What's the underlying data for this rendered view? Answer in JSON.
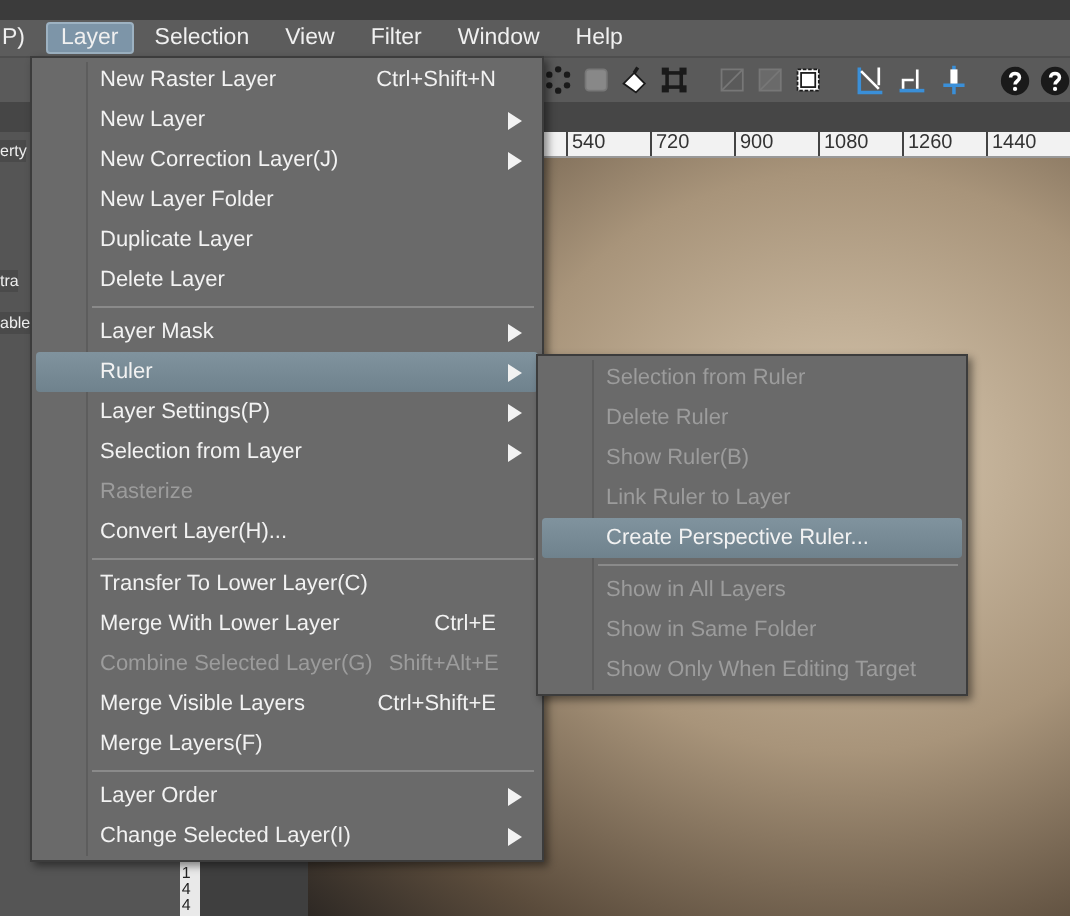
{
  "menubar": [
    {
      "label": "P)",
      "selected": false
    },
    {
      "label": "Layer",
      "selected": true
    },
    {
      "label": "Selection",
      "selected": false
    },
    {
      "label": "View",
      "selected": false
    },
    {
      "label": "Filter",
      "selected": false
    },
    {
      "label": "Window",
      "selected": false
    },
    {
      "label": "Help",
      "selected": false
    }
  ],
  "left_panel": {
    "labels": [
      "erty",
      "tra",
      "able"
    ]
  },
  "ruler": {
    "labels": [
      "540",
      "720",
      "900",
      "1080",
      "1260",
      "1440"
    ]
  },
  "vertical_ruler": {
    "label": "144"
  },
  "menu": {
    "items": [
      {
        "kind": "item",
        "label": "New Raster Layer",
        "shortcut": "Ctrl+Shift+N",
        "submenu": false,
        "disabled": false,
        "selected": false
      },
      {
        "kind": "item",
        "label": "New Layer",
        "submenu": true,
        "disabled": false,
        "selected": false
      },
      {
        "kind": "item",
        "label": "New Correction Layer(J)",
        "submenu": true,
        "disabled": false,
        "selected": false
      },
      {
        "kind": "item",
        "label": "New Layer Folder",
        "submenu": false,
        "disabled": false,
        "selected": false
      },
      {
        "kind": "item",
        "label": "Duplicate Layer",
        "submenu": false,
        "disabled": false,
        "selected": false
      },
      {
        "kind": "item",
        "label": "Delete Layer",
        "submenu": false,
        "disabled": false,
        "selected": false
      },
      {
        "kind": "separator"
      },
      {
        "kind": "item",
        "label": "Layer Mask",
        "submenu": true,
        "disabled": false,
        "selected": false
      },
      {
        "kind": "item",
        "label": "Ruler",
        "submenu": true,
        "disabled": false,
        "selected": true
      },
      {
        "kind": "item",
        "label": "Layer Settings(P)",
        "submenu": true,
        "disabled": false,
        "selected": false
      },
      {
        "kind": "item",
        "label": "Selection from Layer",
        "submenu": true,
        "disabled": false,
        "selected": false
      },
      {
        "kind": "item",
        "label": "Rasterize",
        "submenu": false,
        "disabled": true,
        "selected": false
      },
      {
        "kind": "item",
        "label": "Convert Layer(H)...",
        "submenu": false,
        "disabled": false,
        "selected": false
      },
      {
        "kind": "separator"
      },
      {
        "kind": "item",
        "label": "Transfer To Lower Layer(C)",
        "submenu": false,
        "disabled": false,
        "selected": false
      },
      {
        "kind": "item",
        "label": "Merge With Lower Layer",
        "shortcut": "Ctrl+E",
        "submenu": false,
        "disabled": false,
        "selected": false
      },
      {
        "kind": "item",
        "label": "Combine Selected Layer(G)",
        "shortcut": "Shift+Alt+E",
        "submenu": false,
        "disabled": true,
        "selected": false
      },
      {
        "kind": "item",
        "label": "Merge Visible Layers",
        "shortcut": "Ctrl+Shift+E",
        "submenu": false,
        "disabled": false,
        "selected": false
      },
      {
        "kind": "item",
        "label": "Merge Layers(F)",
        "submenu": false,
        "disabled": false,
        "selected": false
      },
      {
        "kind": "separator"
      },
      {
        "kind": "item",
        "label": "Layer Order",
        "submenu": true,
        "disabled": false,
        "selected": false
      },
      {
        "kind": "item",
        "label": "Change Selected Layer(I)",
        "submenu": true,
        "disabled": false,
        "selected": false
      }
    ]
  },
  "submenu": {
    "items": [
      {
        "kind": "item",
        "label": "Selection from Ruler",
        "disabled": true,
        "selected": false
      },
      {
        "kind": "item",
        "label": "Delete Ruler",
        "disabled": true,
        "selected": false
      },
      {
        "kind": "item",
        "label": "Show Ruler(B)",
        "disabled": true,
        "selected": false
      },
      {
        "kind": "item",
        "label": "Link Ruler to Layer",
        "disabled": true,
        "selected": false
      },
      {
        "kind": "item",
        "label": "Create Perspective Ruler...",
        "disabled": false,
        "selected": true
      },
      {
        "kind": "separator"
      },
      {
        "kind": "item",
        "label": "Show in All Layers",
        "disabled": true,
        "selected": false
      },
      {
        "kind": "item",
        "label": "Show in Same Folder",
        "disabled": true,
        "selected": false
      },
      {
        "kind": "item",
        "label": "Show Only When Editing Target",
        "disabled": true,
        "selected": false
      }
    ]
  }
}
